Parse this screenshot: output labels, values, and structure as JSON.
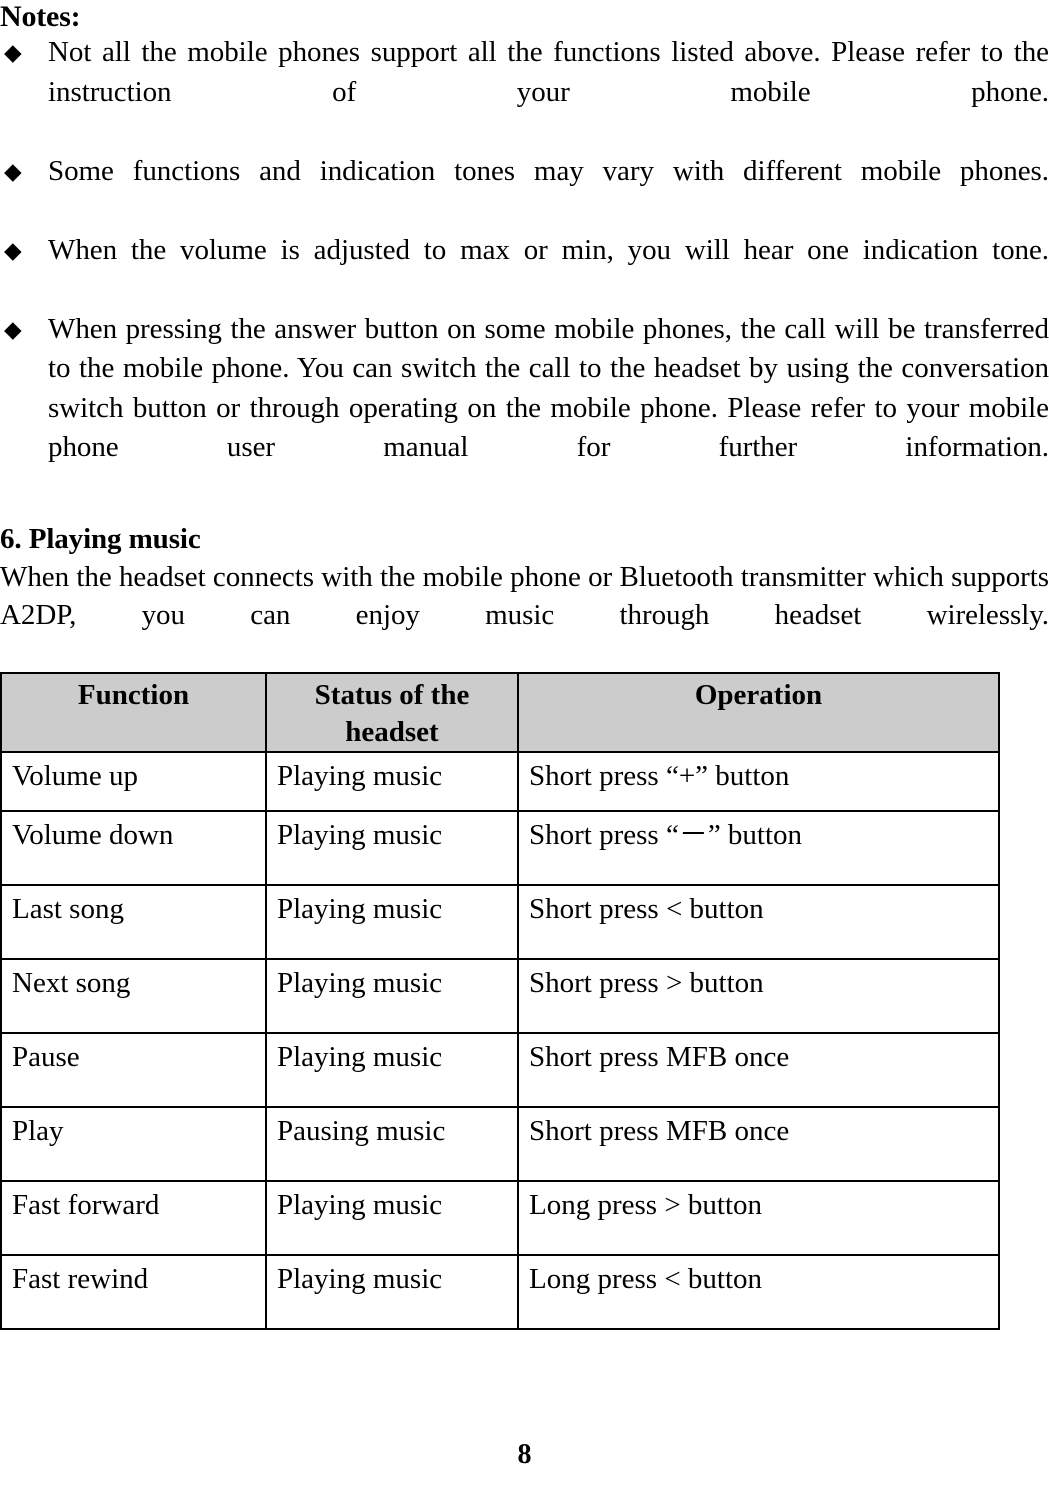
{
  "document": {
    "page_number": "8"
  },
  "notes": {
    "heading": "Notes:",
    "bullet_glyph": "◆",
    "items": [
      "Not all the mobile phones support all the functions listed above. Please refer to the instruction of your mobile phone.",
      "Some functions and indication tones may vary with different mobile phones.",
      "When the volume is adjusted to max or min, you will hear one indication tone.",
      "When pressing the answer button on some mobile phones, the call will be transferred to the mobile phone. You can switch the call to the headset by using the conversation switch button or through operating on the mobile phone. Please refer to your mobile phone user manual for further information."
    ]
  },
  "section": {
    "heading": "6. Playing music",
    "paragraph": "When the headset connects with the mobile phone or Bluetooth transmitter which supports A2DP, you can enjoy music through headset wirelessly."
  },
  "table": {
    "headers": [
      "Function",
      "Status of the headset",
      "Operation"
    ],
    "rows": [
      {
        "function": "Volume up",
        "status": "Playing music",
        "operation": "Short press “+” button"
      },
      {
        "function": "Volume down",
        "status": "Playing music",
        "operation": "Short press “－” button"
      },
      {
        "function": "Last song",
        "status": "Playing music",
        "operation": "Short press < button"
      },
      {
        "function": "Next song",
        "status": "Playing music",
        "operation": "Short press > button"
      },
      {
        "function": "Pause",
        "status": "Playing music",
        "operation": "Short press MFB once"
      },
      {
        "function": "Play",
        "status": "Pausing music",
        "operation": "Short press MFB once"
      },
      {
        "function": "Fast forward",
        "status": "Playing music",
        "operation": "Long press > button"
      },
      {
        "function": "Fast rewind",
        "status": "Playing music",
        "operation": "Long press < button"
      }
    ]
  },
  "colors": {
    "header_fill": "#cccccc",
    "border": "#000000",
    "text": "#000000"
  }
}
